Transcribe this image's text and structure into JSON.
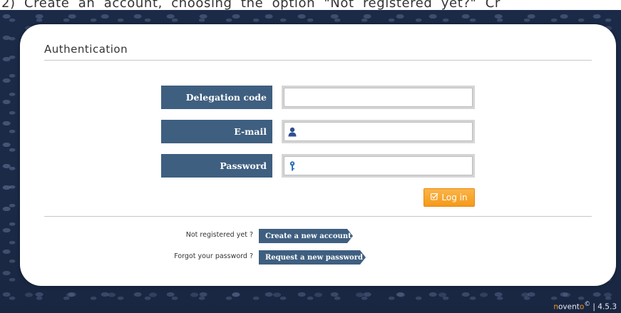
{
  "caption": "2) Create an account, choosing the option \"Not registered yet?\" Cr",
  "panel": {
    "title": "Authentication"
  },
  "form": {
    "delegation_label": "Delegation code",
    "delegation_value": "",
    "email_label": "E-mail",
    "email_value": "",
    "password_label": "Password",
    "password_value": "",
    "login_label": "Log in"
  },
  "links": {
    "register_question": "Not registered yet ?",
    "register_button": "Create a new account",
    "forgot_question": "Forgot your password ?",
    "forgot_button": "Request a new password"
  },
  "footer": {
    "brand_first": "n",
    "brand_mid": "ovent",
    "brand_last": "o",
    "copyright": "©",
    "separator": " | ",
    "version": "4.5.3"
  },
  "colors": {
    "label_bg": "#3f5f80",
    "login_button": "#f49a1a",
    "background": "#1b2a47"
  },
  "icons": {
    "email": "user-icon",
    "password": "key-icon",
    "login": "checkbox-icon"
  }
}
